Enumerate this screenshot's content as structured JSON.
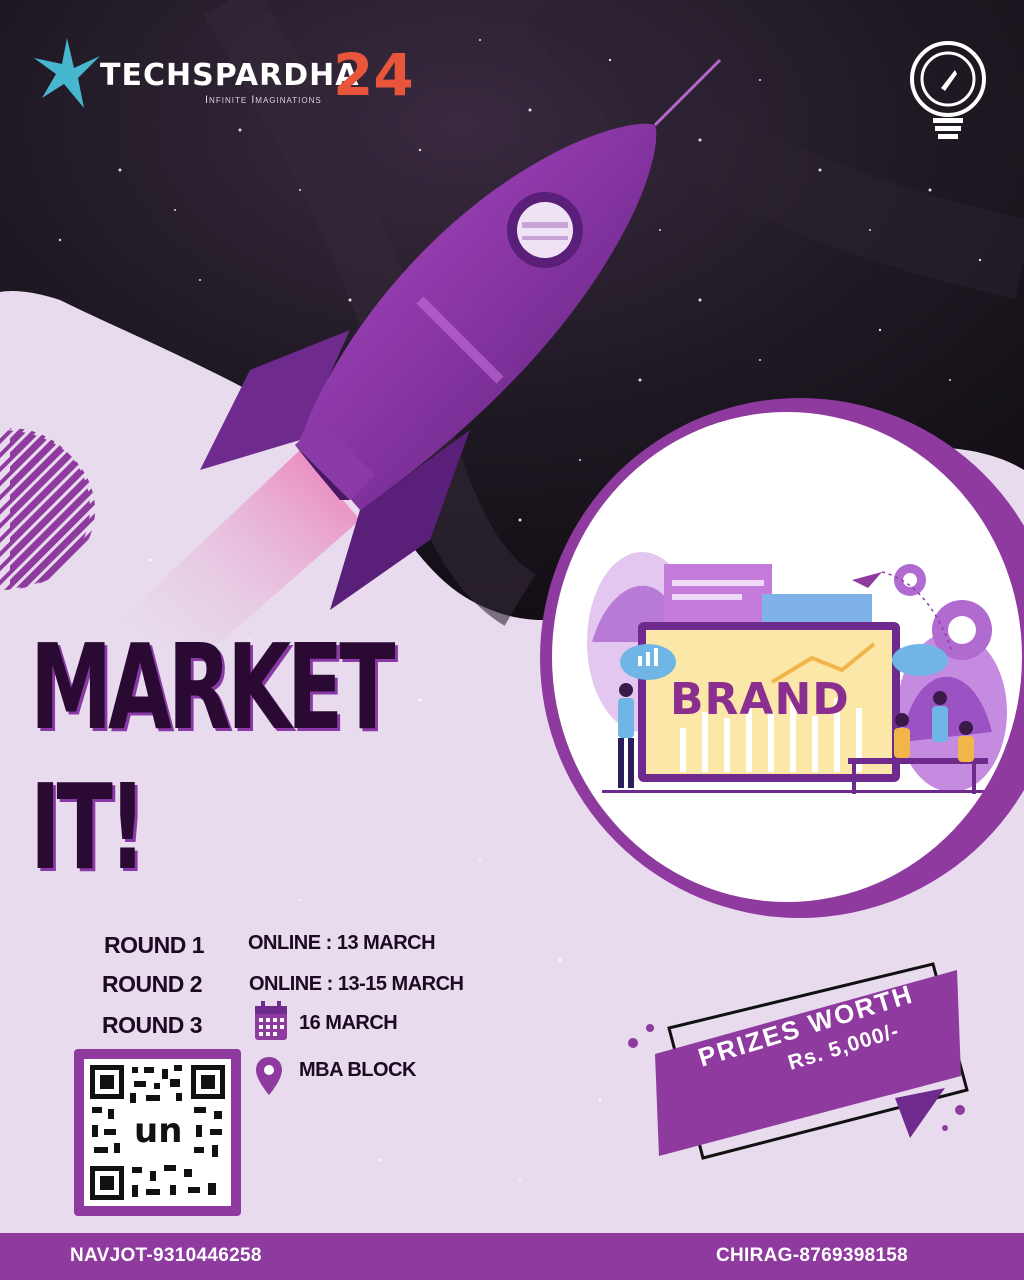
{
  "event": {
    "name": "TECHSPARDHA",
    "year": "24",
    "tagline": "Infinite Imaginations"
  },
  "title": {
    "line1": "MARKET",
    "line2": "IT!"
  },
  "illustration": {
    "word": "BRAND"
  },
  "rounds": [
    {
      "label": "ROUND 1",
      "value": "ONLINE : 13 MARCH"
    },
    {
      "label": "ROUND 2",
      "value": "ONLINE : 13-15 MARCH"
    },
    {
      "label": "ROUND 3",
      "value": "16 MARCH",
      "icon": "calendar-icon"
    }
  ],
  "venue": {
    "value": "MBA BLOCK",
    "icon": "location-pin-icon"
  },
  "qr": {
    "center_text": "un"
  },
  "prize": {
    "line1": "PRIZES WORTH",
    "line2": "Rs. 5,000/-"
  },
  "contacts": {
    "left": "NAVJOT-9310446258",
    "right": "CHIRAG-8769398158"
  },
  "colors": {
    "primary_purple": "#8e3a9f",
    "dark_space": "#1c1620",
    "logo_accent": "#e8553a",
    "title_dark": "#2a0a33"
  }
}
